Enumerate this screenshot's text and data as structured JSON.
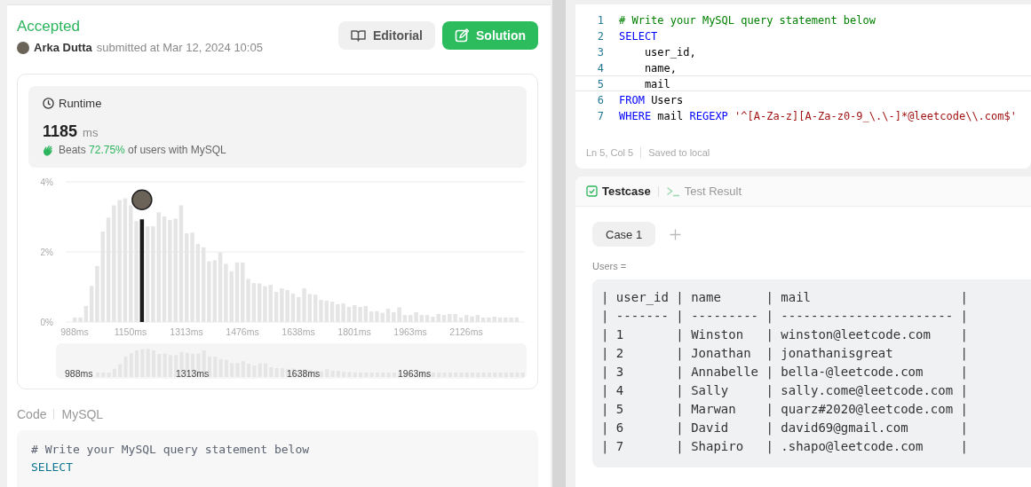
{
  "submission": {
    "status": "Accepted",
    "author": "Arka Dutta",
    "submitted_text": "submitted at Mar 12, 2024 10:05",
    "buttons": [
      {
        "label": "Editorial",
        "kind": "secondary"
      },
      {
        "label": "Solution",
        "kind": "primary"
      }
    ]
  },
  "runtime": {
    "title": "Runtime",
    "value": "1185",
    "unit": "ms",
    "beats_prefix": "Beats",
    "beats_percent": "72.75%",
    "beats_suffix": "of users with MySQL"
  },
  "histogram": {
    "chart_data": {
      "type": "bar",
      "ylim": [
        0,
        4
      ],
      "yticks": [
        {
          "value": 0,
          "label": "0%"
        },
        {
          "value": 2,
          "label": "2%"
        },
        {
          "value": 4,
          "label": "4%"
        }
      ],
      "categories": [
        "988ms",
        null,
        null,
        null,
        null,
        null,
        null,
        null,
        null,
        null,
        "1150ms",
        null,
        null,
        null,
        null,
        null,
        null,
        null,
        null,
        null,
        "1313ms",
        null,
        null,
        null,
        null,
        null,
        null,
        null,
        null,
        null,
        "1476ms",
        null,
        null,
        null,
        null,
        null,
        null,
        null,
        null,
        null,
        "1638ms",
        null,
        null,
        null,
        null,
        null,
        null,
        null,
        null,
        null,
        "1801ms",
        null,
        null,
        null,
        null,
        null,
        null,
        null,
        null,
        null,
        "1963ms",
        null,
        null,
        null,
        null,
        null,
        null,
        null,
        null,
        null,
        "2126ms",
        null,
        null,
        null,
        null,
        null,
        null,
        null,
        null,
        null
      ],
      "series": [
        {
          "color": "#1a1a1a",
          "values": [
            null,
            null,
            null,
            null,
            null,
            null,
            null,
            null,
            null,
            null,
            null,
            null,
            2.93,
            null,
            null,
            null,
            null,
            null,
            null,
            null,
            null,
            null,
            null,
            null,
            null,
            null,
            null,
            null,
            null,
            null,
            null,
            null,
            null,
            null,
            null,
            null,
            null,
            null,
            null,
            null,
            null,
            null,
            null,
            null,
            null,
            null,
            null,
            null,
            null,
            null,
            null,
            null,
            null,
            null,
            null,
            null,
            null,
            null,
            null,
            null,
            null,
            null,
            null,
            null,
            null,
            null,
            null,
            null,
            null,
            null,
            null,
            null,
            null,
            null,
            null,
            null,
            null,
            null,
            null,
            null
          ]
        },
        {
          "color": "#e5e5e5",
          "values": [
            0.13,
            0.13,
            0.46,
            1.03,
            1.6,
            2.58,
            2.98,
            3.33,
            3.48,
            3.53,
            3.33,
            2.88,
            null,
            2.73,
            2.73,
            3.13,
            3.01,
            2.91,
            2.95,
            3.33,
            2.53,
            2.55,
            2.23,
            2.13,
            1.73,
            1.76,
            1.98,
            1.66,
            1.45,
            1.7,
            1.7,
            1.23,
            1.11,
            1.1,
            1.02,
            1.06,
            0.86,
            0.96,
            0.91,
            0.81,
            0.71,
            0.96,
            0.8,
            0.78,
            0.63,
            0.61,
            0.58,
            0.51,
            0.53,
            0.43,
            0.48,
            0.43,
            0.46,
            0.3,
            0.31,
            0.26,
            0.38,
            0.28,
            0.42,
            0.2,
            0.2,
            0.28,
            0.2,
            0.2,
            0.15,
            0.23,
            0.2,
            0.23,
            0.23,
            0.13,
            0.2,
            0.16,
            0.2,
            0.13,
            0.13,
            0.15,
            0.13,
            0.13,
            0.13,
            0.13
          ]
        }
      ]
    },
    "overview_labels": [
      "988ms",
      "1313ms",
      "1638ms",
      "1963ms"
    ]
  },
  "code_view": {
    "label": "Code",
    "language": "MySQL",
    "lines": [
      [
        {
          "kind": "comment",
          "text": "# Write your MySQL query statement below"
        }
      ],
      [
        {
          "kind": "keyword",
          "text": "SELECT"
        }
      ]
    ]
  },
  "editor": {
    "lines": [
      {
        "number": "1",
        "current": false,
        "tokens": [
          {
            "kind": "comment",
            "text": "# Write your MySQL query statement below"
          }
        ]
      },
      {
        "number": "2",
        "current": false,
        "tokens": [
          {
            "kind": "keyword",
            "text": "SELECT"
          }
        ]
      },
      {
        "number": "3",
        "current": false,
        "tokens": [
          {
            "kind": "plain",
            "text": "    user_id,"
          }
        ]
      },
      {
        "number": "4",
        "current": false,
        "tokens": [
          {
            "kind": "plain",
            "text": "    name,"
          }
        ]
      },
      {
        "number": "5",
        "current": true,
        "tokens": [
          {
            "kind": "plain",
            "text": "    mail"
          }
        ]
      },
      {
        "number": "6",
        "current": false,
        "tokens": [
          {
            "kind": "keyword",
            "text": "FROM"
          },
          {
            "kind": "plain",
            "text": " Users"
          }
        ]
      },
      {
        "number": "7",
        "current": false,
        "tokens": [
          {
            "kind": "keyword",
            "text": "WHERE"
          },
          {
            "kind": "plain",
            "text": " mail "
          },
          {
            "kind": "keyword",
            "text": "REGEXP"
          },
          {
            "kind": "string",
            "text": " '^[A-Za-z][A-Za-z0-9_\\.\\-]*@leetcode\\\\.com$'"
          }
        ]
      }
    ],
    "status": [
      "Ln 5, Col 5",
      "Saved to local"
    ]
  },
  "testcase_panel": {
    "tabs": [
      {
        "label": "Testcase",
        "kind": "testcase",
        "selected": true
      },
      {
        "label": "Test Result",
        "kind": "result",
        "selected": false
      }
    ],
    "cases": [
      {
        "label": "Case 1",
        "selected": true
      }
    ],
    "input_label": "Users =",
    "table_lines": [
      "| user_id | name      | mail                    |",
      "| ------- | --------- | ----------------------- |",
      "| 1       | Winston   | winston@leetcode.com    |",
      "| 2       | Jonathan  | jonathanisgreat         |",
      "| 3       | Annabelle | bella-@leetcode.com     |",
      "| 4       | Sally     | sally.come@leetcode.com |",
      "| 5       | Marwan    | quarz#2020@leetcode.com |",
      "| 6       | David     | david69@gmail.com       |",
      "| 7       | Shapiro   | .shapo@leetcode.com     |"
    ]
  }
}
